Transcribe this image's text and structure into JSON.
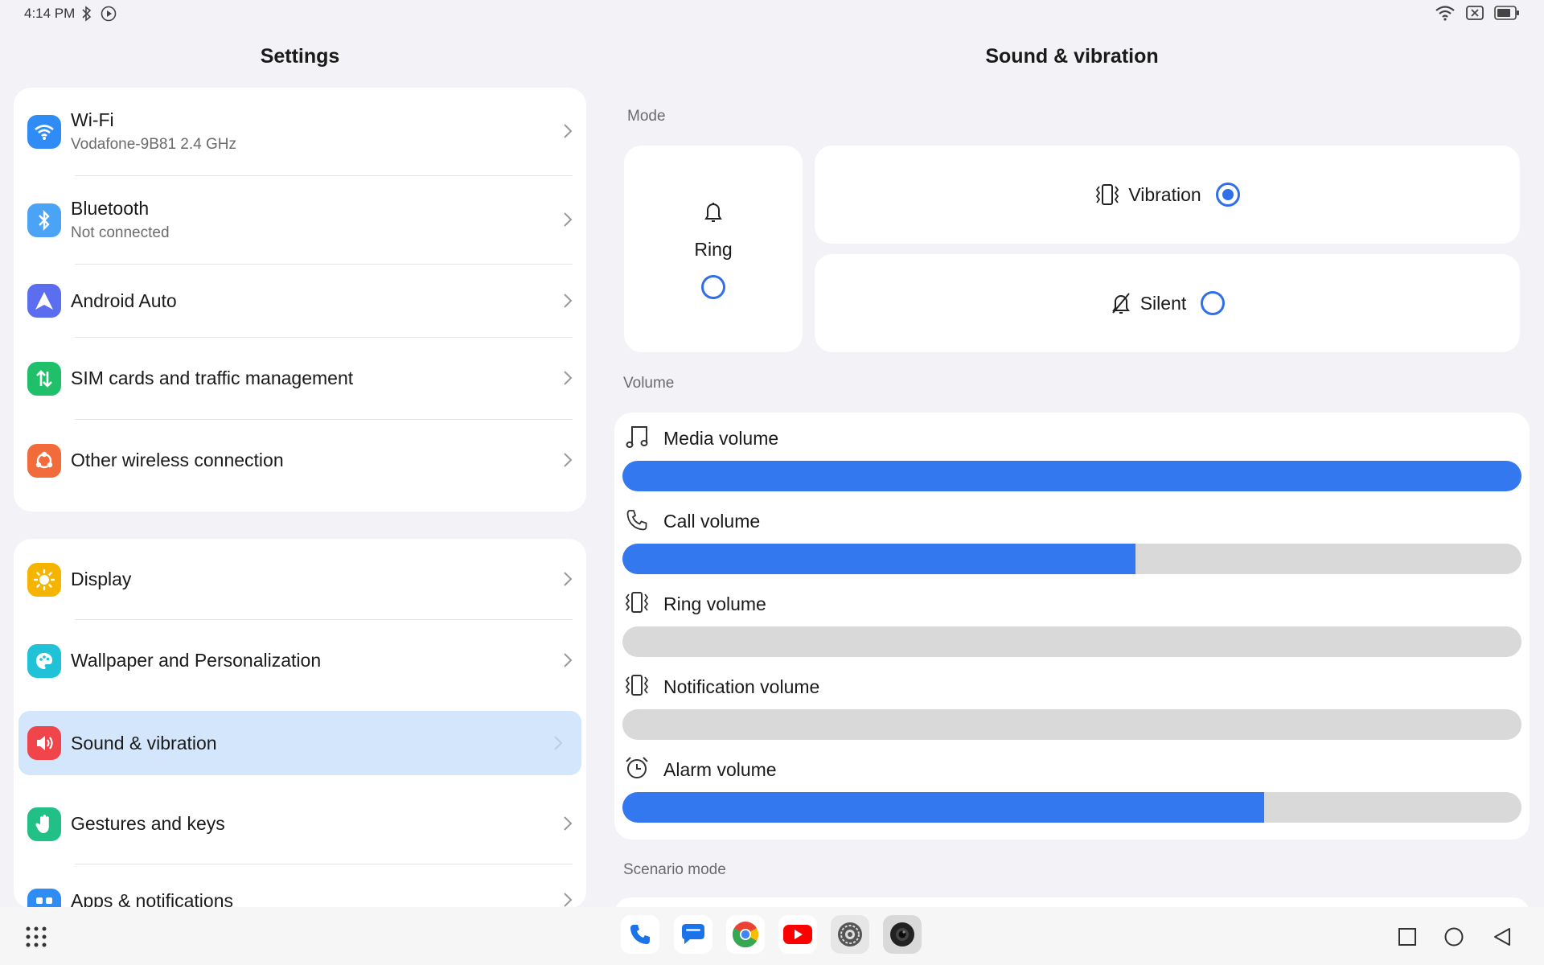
{
  "status": {
    "time": "4:14 PM"
  },
  "left": {
    "title": "Settings",
    "group1": [
      {
        "label": "Wi-Fi",
        "sub": "Vodafone-9B81 2.4 GHz",
        "icon": "wifi-icon",
        "color": "#2f8cf5"
      },
      {
        "label": "Bluetooth",
        "sub": "Not connected",
        "icon": "bluetooth-icon",
        "color": "#4aa3f5"
      },
      {
        "label": "Android Auto",
        "icon": "android-auto-icon",
        "color": "#5b6ef0"
      },
      {
        "label": "SIM cards and traffic management",
        "icon": "sim-traffic-icon",
        "color": "#20c06a"
      },
      {
        "label": "Other wireless connection",
        "icon": "wireless-connection-icon",
        "color": "#f26b3a"
      }
    ],
    "group2": [
      {
        "label": "Display",
        "icon": "display-sun-icon",
        "color": "#f5b400"
      },
      {
        "label": "Wallpaper and Personalization",
        "icon": "palette-icon",
        "color": "#1fc2d6"
      },
      {
        "label": "Sound & vibration",
        "icon": "speaker-icon",
        "color": "#f0454a",
        "selected": true
      },
      {
        "label": "Gestures and keys",
        "icon": "hand-icon",
        "color": "#20c087"
      },
      {
        "label": "Apps & notifications",
        "icon": "apps-icon",
        "color": "#2f8cf5"
      }
    ]
  },
  "right": {
    "title": "Sound & vibration",
    "mode_label": "Mode",
    "modes": {
      "ring": "Ring",
      "vibration": "Vibration",
      "silent": "Silent",
      "selected": "Vibration"
    },
    "volume_label": "Volume",
    "volumes": [
      {
        "label": "Media volume",
        "icon": "music-note-icon",
        "level": 1.0
      },
      {
        "label": "Call volume",
        "icon": "phone-icon",
        "level": 0.571
      },
      {
        "label": "Ring volume",
        "icon": "vibrate-icon",
        "level": 0.0
      },
      {
        "label": "Notification volume",
        "icon": "vibrate-icon",
        "level": 0.0
      },
      {
        "label": "Alarm volume",
        "icon": "alarm-clock-icon",
        "level": 0.714
      }
    ],
    "scenario_label": "Scenario mode"
  },
  "colors": {
    "accent": "#3478f0",
    "selected_row": "#d3e6fb",
    "track": "#d9d9d9"
  },
  "dock": [
    "phone-app-icon",
    "messages-app-icon",
    "chrome-app-icon",
    "youtube-app-icon",
    "settings-app-icon",
    "camera-app-icon"
  ]
}
